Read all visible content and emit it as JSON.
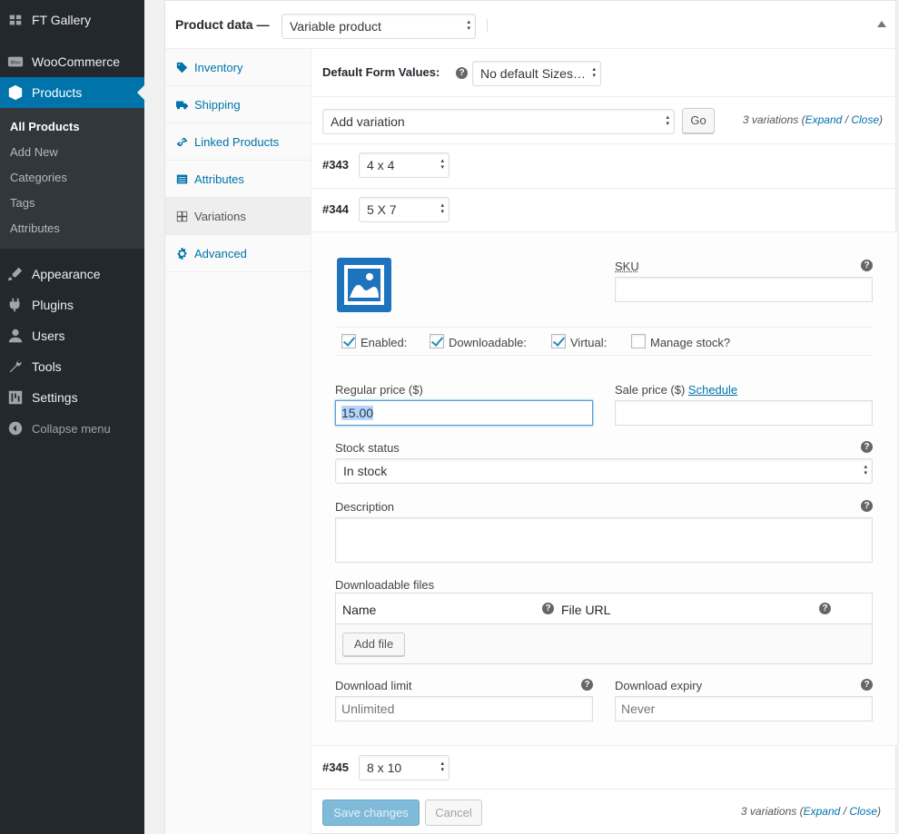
{
  "sidebar": {
    "site_name": "FT Gallery",
    "woocommerce": "WooCommerce",
    "products": "Products",
    "sub": [
      "All Products",
      "Add New",
      "Categories",
      "Tags",
      "Attributes"
    ],
    "appearance": "Appearance",
    "plugins": "Plugins",
    "users": "Users",
    "tools": "Tools",
    "settings": "Settings",
    "collapse": "Collapse menu"
  },
  "header": {
    "title": "Product data —",
    "type_select": "Variable product"
  },
  "tabs": [
    "Inventory",
    "Shipping",
    "Linked Products",
    "Attributes",
    "Variations",
    "Advanced"
  ],
  "defaults": {
    "label": "Default Form Values:",
    "select": "No default Sizes…"
  },
  "toolbar": {
    "action_select": "Add variation",
    "go": "Go",
    "count": "3 variations (",
    "expand": "Expand",
    "slash": " / ",
    "close": "Close",
    ")": ")"
  },
  "variations": [
    {
      "id": "#343",
      "size": "4 x 4"
    },
    {
      "id": "#344",
      "size": "5 X 7"
    },
    {
      "id": "#345",
      "size": "8 x 10"
    }
  ],
  "form": {
    "sku": "SKU",
    "enabled": "Enabled:",
    "downloadable": "Downloadable:",
    "virtual": "Virtual:",
    "manage_stock": "Manage stock?",
    "regular_price_label": "Regular price ($)",
    "regular_price": "15.00",
    "sale_price_label": "Sale price ($) ",
    "schedule": "Schedule",
    "stock_status_label": "Stock status",
    "stock_status": "In stock",
    "description": "Description",
    "downloadable_files": "Downloadable files",
    "col_name": "Name",
    "col_url": "File URL",
    "add_file": "Add file",
    "download_limit": "Download limit",
    "download_limit_ph": "Unlimited",
    "download_expiry": "Download expiry",
    "download_expiry_ph": "Never"
  },
  "footer": {
    "save": "Save changes",
    "cancel": "Cancel"
  }
}
